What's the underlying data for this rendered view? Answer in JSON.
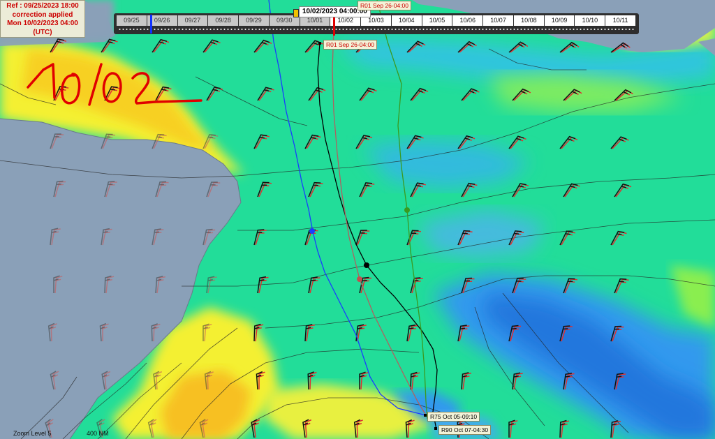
{
  "ref_box": {
    "line1": "Ref : 09/25/2023 18:00",
    "line2": "correction applied",
    "line3": "Mon 10/02/2023 04:00",
    "line4": "(UTC)"
  },
  "timeline": {
    "current_time": "10/02/2023 04:00:00",
    "dates": [
      "09/25",
      "09/26",
      "09/27",
      "09/28",
      "09/29",
      "09/30",
      "10/01",
      "10/02",
      "10/03",
      "10/04",
      "10/05",
      "10/06",
      "10/07",
      "10/08",
      "10/09",
      "10/10",
      "10/11"
    ],
    "past_count": 7
  },
  "labels": {
    "route_start_top": "R01 Sep 26-04:00",
    "route_start": "R01 Sep 26-04:00",
    "route_r75": "R75 Oct 05-09:10",
    "route_r90": "R90 Oct 07-04:30"
  },
  "annotation": {
    "handwritten": "10/02"
  },
  "footer": {
    "zoom": "Zoom Level 5",
    "scale": "400 NM"
  },
  "colors": {
    "route_blue": "#1a3cff",
    "route_black": "#000000",
    "route_brown": "#b06060",
    "route_green": "#3a9a20",
    "handwriting": "#e00000",
    "land": "#8aa0b8",
    "sea_green": "#22dd99",
    "sea_blue": "#3399ee",
    "sea_yellow": "#f4f030"
  }
}
